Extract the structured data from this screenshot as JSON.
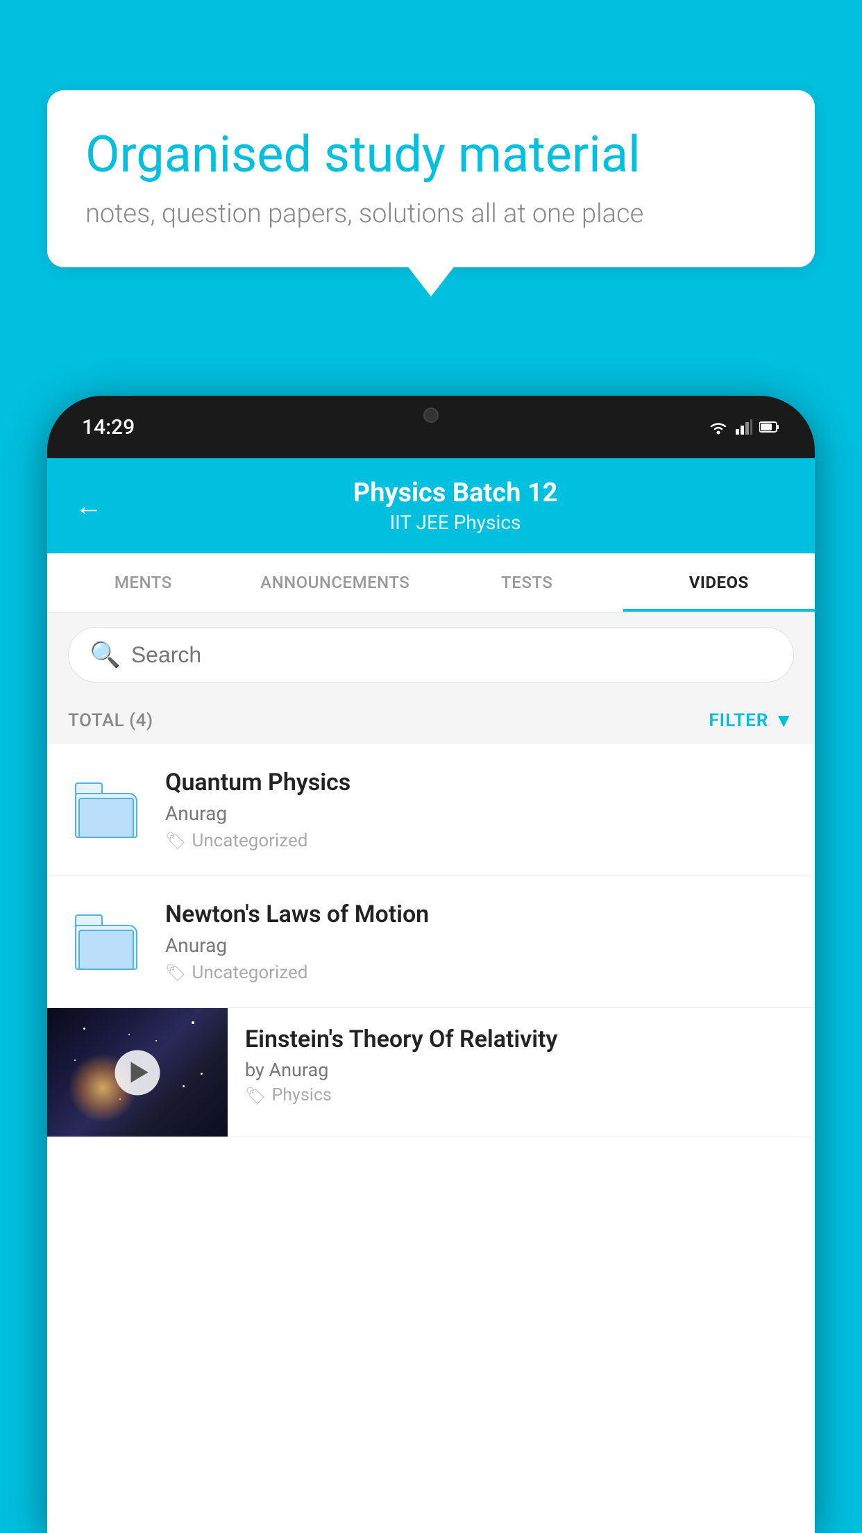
{
  "background_color": "#00BFDF",
  "speech_bubble": {
    "heading": "Organised study material",
    "subtext": "notes, question papers, solutions all at one place"
  },
  "phone": {
    "status_bar": {
      "time": "14:29"
    },
    "header": {
      "back_label": "←",
      "batch_name": "Physics Batch 12",
      "batch_tags": "IIT JEE   Physics"
    },
    "tabs": [
      {
        "label": "MENTS",
        "active": false
      },
      {
        "label": "ANNOUNCEMENTS",
        "active": false
      },
      {
        "label": "TESTS",
        "active": false
      },
      {
        "label": "VIDEOS",
        "active": true
      }
    ],
    "search": {
      "placeholder": "Search"
    },
    "filter_row": {
      "total_label": "TOTAL (4)",
      "filter_label": "FILTER"
    },
    "videos": [
      {
        "id": 1,
        "title": "Quantum Physics",
        "author": "Anurag",
        "tag": "Uncategorized",
        "type": "folder"
      },
      {
        "id": 2,
        "title": "Newton's Laws of Motion",
        "author": "Anurag",
        "tag": "Uncategorized",
        "type": "folder"
      },
      {
        "id": 3,
        "title": "Einstein's Theory Of Relativity",
        "author": "by Anurag",
        "tag": "Physics",
        "type": "thumbnail"
      }
    ]
  }
}
